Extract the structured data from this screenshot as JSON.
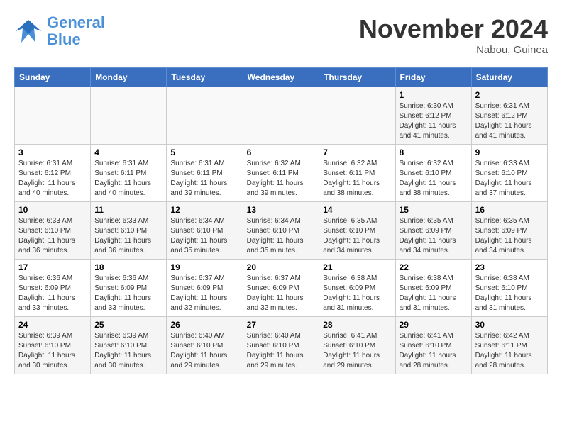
{
  "logo": {
    "line1": "General",
    "line2": "Blue"
  },
  "title": "November 2024",
  "location": "Nabou, Guinea",
  "days_of_week": [
    "Sunday",
    "Monday",
    "Tuesday",
    "Wednesday",
    "Thursday",
    "Friday",
    "Saturday"
  ],
  "weeks": [
    [
      {
        "day": "",
        "info": ""
      },
      {
        "day": "",
        "info": ""
      },
      {
        "day": "",
        "info": ""
      },
      {
        "day": "",
        "info": ""
      },
      {
        "day": "",
        "info": ""
      },
      {
        "day": "1",
        "info": "Sunrise: 6:30 AM\nSunset: 6:12 PM\nDaylight: 11 hours\nand 41 minutes."
      },
      {
        "day": "2",
        "info": "Sunrise: 6:31 AM\nSunset: 6:12 PM\nDaylight: 11 hours\nand 41 minutes."
      }
    ],
    [
      {
        "day": "3",
        "info": "Sunrise: 6:31 AM\nSunset: 6:12 PM\nDaylight: 11 hours\nand 40 minutes."
      },
      {
        "day": "4",
        "info": "Sunrise: 6:31 AM\nSunset: 6:11 PM\nDaylight: 11 hours\nand 40 minutes."
      },
      {
        "day": "5",
        "info": "Sunrise: 6:31 AM\nSunset: 6:11 PM\nDaylight: 11 hours\nand 39 minutes."
      },
      {
        "day": "6",
        "info": "Sunrise: 6:32 AM\nSunset: 6:11 PM\nDaylight: 11 hours\nand 39 minutes."
      },
      {
        "day": "7",
        "info": "Sunrise: 6:32 AM\nSunset: 6:11 PM\nDaylight: 11 hours\nand 38 minutes."
      },
      {
        "day": "8",
        "info": "Sunrise: 6:32 AM\nSunset: 6:10 PM\nDaylight: 11 hours\nand 38 minutes."
      },
      {
        "day": "9",
        "info": "Sunrise: 6:33 AM\nSunset: 6:10 PM\nDaylight: 11 hours\nand 37 minutes."
      }
    ],
    [
      {
        "day": "10",
        "info": "Sunrise: 6:33 AM\nSunset: 6:10 PM\nDaylight: 11 hours\nand 36 minutes."
      },
      {
        "day": "11",
        "info": "Sunrise: 6:33 AM\nSunset: 6:10 PM\nDaylight: 11 hours\nand 36 minutes."
      },
      {
        "day": "12",
        "info": "Sunrise: 6:34 AM\nSunset: 6:10 PM\nDaylight: 11 hours\nand 35 minutes."
      },
      {
        "day": "13",
        "info": "Sunrise: 6:34 AM\nSunset: 6:10 PM\nDaylight: 11 hours\nand 35 minutes."
      },
      {
        "day": "14",
        "info": "Sunrise: 6:35 AM\nSunset: 6:10 PM\nDaylight: 11 hours\nand 34 minutes."
      },
      {
        "day": "15",
        "info": "Sunrise: 6:35 AM\nSunset: 6:09 PM\nDaylight: 11 hours\nand 34 minutes."
      },
      {
        "day": "16",
        "info": "Sunrise: 6:35 AM\nSunset: 6:09 PM\nDaylight: 11 hours\nand 34 minutes."
      }
    ],
    [
      {
        "day": "17",
        "info": "Sunrise: 6:36 AM\nSunset: 6:09 PM\nDaylight: 11 hours\nand 33 minutes."
      },
      {
        "day": "18",
        "info": "Sunrise: 6:36 AM\nSunset: 6:09 PM\nDaylight: 11 hours\nand 33 minutes."
      },
      {
        "day": "19",
        "info": "Sunrise: 6:37 AM\nSunset: 6:09 PM\nDaylight: 11 hours\nand 32 minutes."
      },
      {
        "day": "20",
        "info": "Sunrise: 6:37 AM\nSunset: 6:09 PM\nDaylight: 11 hours\nand 32 minutes."
      },
      {
        "day": "21",
        "info": "Sunrise: 6:38 AM\nSunset: 6:09 PM\nDaylight: 11 hours\nand 31 minutes."
      },
      {
        "day": "22",
        "info": "Sunrise: 6:38 AM\nSunset: 6:09 PM\nDaylight: 11 hours\nand 31 minutes."
      },
      {
        "day": "23",
        "info": "Sunrise: 6:38 AM\nSunset: 6:10 PM\nDaylight: 11 hours\nand 31 minutes."
      }
    ],
    [
      {
        "day": "24",
        "info": "Sunrise: 6:39 AM\nSunset: 6:10 PM\nDaylight: 11 hours\nand 30 minutes."
      },
      {
        "day": "25",
        "info": "Sunrise: 6:39 AM\nSunset: 6:10 PM\nDaylight: 11 hours\nand 30 minutes."
      },
      {
        "day": "26",
        "info": "Sunrise: 6:40 AM\nSunset: 6:10 PM\nDaylight: 11 hours\nand 29 minutes."
      },
      {
        "day": "27",
        "info": "Sunrise: 6:40 AM\nSunset: 6:10 PM\nDaylight: 11 hours\nand 29 minutes."
      },
      {
        "day": "28",
        "info": "Sunrise: 6:41 AM\nSunset: 6:10 PM\nDaylight: 11 hours\nand 29 minutes."
      },
      {
        "day": "29",
        "info": "Sunrise: 6:41 AM\nSunset: 6:10 PM\nDaylight: 11 hours\nand 28 minutes."
      },
      {
        "day": "30",
        "info": "Sunrise: 6:42 AM\nSunset: 6:11 PM\nDaylight: 11 hours\nand 28 minutes."
      }
    ]
  ]
}
